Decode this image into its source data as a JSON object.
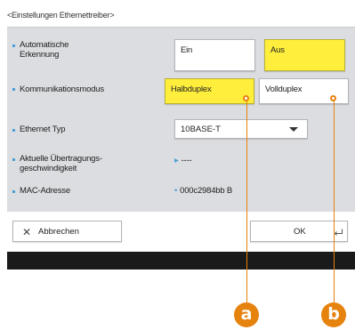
{
  "screen": {
    "title": "<Einstellungen Ethernettreiber>"
  },
  "settings": {
    "auto_detect": {
      "label": "Automatische Erkennung",
      "on_label": "Ein",
      "off_label": "Aus",
      "selected": "Aus"
    },
    "comm_mode": {
      "label": "Kommunikationsmodus",
      "half_label": "Halbduplex",
      "full_label": "Vollduplex",
      "selected": "Halbduplex"
    },
    "ethernet_type": {
      "label": "Ethernet Typ",
      "value": "10BASE-T"
    },
    "transfer_speed": {
      "label": "Aktuelle Übertragungs-geschwindigkeit",
      "value": "----"
    },
    "mac_address": {
      "label": "MAC-Adresse",
      "value": "000c2984bb B"
    }
  },
  "footer": {
    "cancel_label": "Abbrechen",
    "ok_label": "OK"
  },
  "callouts": {
    "a": "a",
    "b": "b"
  },
  "colors": {
    "selected": "#ffee3c",
    "accent": "#4a9fd8",
    "callout": "#e6820e"
  }
}
